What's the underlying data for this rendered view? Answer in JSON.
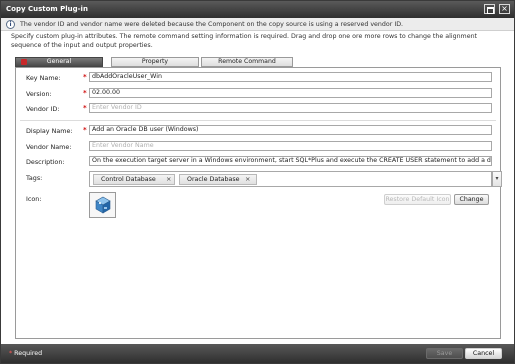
{
  "window": {
    "title": "Copy Custom Plug-in",
    "maximize_icon": "maximize-icon",
    "close_icon": "close-icon"
  },
  "notice": {
    "icon": "info-icon",
    "text": "The vendor ID and vendor name were deleted because the Component on the copy source is using a reserved vendor ID."
  },
  "instructions": "Specify custom plug-in attributes. The remote command setting information is required. Drag and drop one ore more rows to change the alignment sequence of the input and output properties.",
  "tabs": [
    {
      "label": "General",
      "active": true
    },
    {
      "label": "Property",
      "active": false
    },
    {
      "label": "Remote Command",
      "active": false
    }
  ],
  "form": {
    "key_name": {
      "label": "Key Name:",
      "required": "*",
      "value": "dbAddOracleUser_Win"
    },
    "version": {
      "label": "Version:",
      "required": "*",
      "value": "02.00.00"
    },
    "vendor_id": {
      "label": "Vendor ID:",
      "required": "*",
      "value": "",
      "placeholder": "Enter Vendor ID"
    },
    "display_name": {
      "label": "Display Name:",
      "required": "*",
      "value": "Add an Oracle DB user (Windows)"
    },
    "vendor_name": {
      "label": "Vendor Name:",
      "value": "",
      "placeholder": "Enter Vendor Name"
    },
    "description": {
      "label": "Description:",
      "value": "On the execution target server in a Windows environment, start SQL*Plus  and execute the CREATE USER statement to add a d"
    },
    "tags": {
      "label": "Tags:",
      "items": [
        "Control Database",
        "Oracle Database"
      ],
      "remove_glyph": "×",
      "dropdown_glyph": "▾"
    },
    "icon": {
      "label": "Icon:",
      "icon_name": "plugin-cube-icon"
    }
  },
  "buttons": {
    "restore_default_icon": "Restore Default Icon",
    "change": "Change",
    "save": "Save",
    "cancel": "Cancel"
  },
  "footer": {
    "required_star": "*",
    "required_text": " Required"
  },
  "colors": {
    "required_star": "#d01010",
    "active_tab": "#5a5a5a",
    "titlebar": "#3a3a3a"
  }
}
